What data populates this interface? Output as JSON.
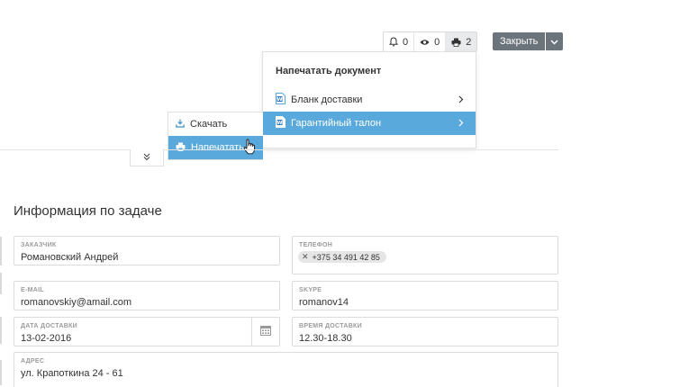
{
  "toolbar": {
    "notifications_count": "0",
    "views_count": "0",
    "print_count": "2",
    "close_label": "Закрыть"
  },
  "print_menu": {
    "title": "Напечатать документ",
    "items": [
      {
        "label": "Бланк доставки"
      },
      {
        "label": "Гарантийный талон"
      }
    ]
  },
  "action_menu": {
    "items": [
      {
        "label": "Скачать"
      },
      {
        "label": "Напечатать"
      }
    ]
  },
  "section": {
    "title": "Информация по задаче"
  },
  "fields": {
    "customer": {
      "label": "ЗАКАЗЧИК",
      "value": "Романовский Андрей"
    },
    "phone": {
      "label": "ТЕЛЕФОН",
      "chip": "+375 34 491 42 85"
    },
    "email": {
      "label": "E-MAIL",
      "value": "romanovskiy@amail.com"
    },
    "skype": {
      "label": "SKYPE",
      "value": "romanov14"
    },
    "delivery_date": {
      "label": "ДАТА ДОСТАВКИ",
      "value": "13-02-2016"
    },
    "delivery_time": {
      "label": "ВРЕМЯ ДОСТАВКИ",
      "value": "12.30-18.30"
    },
    "address": {
      "label": "АДРЕС",
      "value": "ул. Крапоткина 24 - 61"
    }
  },
  "colors": {
    "accent": "#5aa9dc",
    "close_button": "#6b737b"
  },
  "icons": {
    "bell": "bell-icon",
    "eye": "eye-icon",
    "printer": "printer-icon",
    "document": "word-document-icon",
    "download": "download-icon",
    "calendar": "calendar-icon",
    "expand": "double-chevron-down-icon"
  }
}
